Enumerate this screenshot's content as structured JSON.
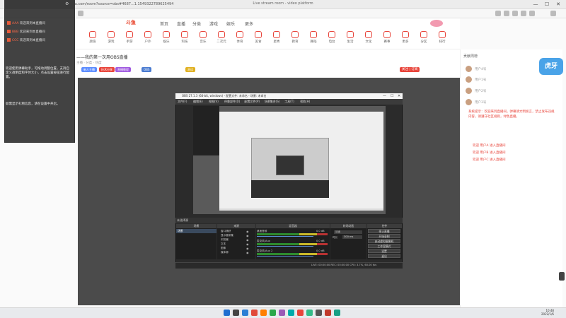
{
  "browser": {
    "tab_title": "Live stream room - video platform",
    "url": "https://www.douyu.com/room?source=obs#4687...1.1549322789625494",
    "controls": {
      "minimize": "—",
      "maximize": "☐",
      "close": "✕"
    }
  },
  "site": {
    "logo": "斗鱼",
    "nav": [
      "首页",
      "直播",
      "分类",
      "游戏",
      "娱乐",
      "更多"
    ],
    "categories": [
      "颜值",
      "游戏",
      "手游",
      "户外",
      "娱乐",
      "科技",
      "音乐",
      "二次元",
      "体育",
      "美食",
      "星秀",
      "教育",
      "舞蹈",
      "电台",
      "生活",
      "文化",
      "赛事",
      "更多",
      "分区",
      "排行"
    ]
  },
  "room": {
    "title": "——我的第一次用OBS直播",
    "subtitle": "主播 · 分类 · 热度",
    "tags": [
      "新人主播",
      "技术分享",
      "直播教程",
      "OBS",
      "测试"
    ],
    "follow_button": "关注 | 订阅"
  },
  "rank": {
    "header": "贡献周榜",
    "rows": [
      "用户1号",
      "用户2号",
      "用户3号",
      "用户4号"
    ]
  },
  "chat": {
    "note": "系统提示：欢迎来到直播间，弹幕请文明发言，禁止发布违规内容，请遵守社区规则，绿色直播。",
    "lines": [
      "欢迎 用户A 进入直播间",
      "欢迎 用户B 进入直播间",
      "欢迎 用户C 进入直播间"
    ]
  },
  "badge": {
    "text": "虎牙"
  },
  "dock": {
    "rows": [
      {
        "name": "AAA",
        "text": "欢迎来到本直播间"
      },
      {
        "name": "BBB",
        "text": "欢迎来到本直播间"
      },
      {
        "name": "CCC",
        "text": "欢迎来到本直播间"
      }
    ],
    "message1": "欢迎使用弹幕助手，可拖动调整位置，支持自定义透明度和字体大小，点击设置按钮进行配置。",
    "message2": "如需显示礼物信息，请在设置中开启。"
  },
  "obs": {
    "title": "OBS 27.1.3 (64-bit, windows) - 配置文件: 未命名 - 场景: 未命名",
    "menu": [
      "文件(F)",
      "编辑(E)",
      "视图(V)",
      "停靠部件(D)",
      "配置文件(P)",
      "场景集合(S)",
      "工具(T)",
      "帮助(H)"
    ],
    "stage_label": "未选择源",
    "panels": [
      "场景",
      "来源",
      "混音器",
      "转场动画",
      "控件"
    ],
    "scene": "场景",
    "sources": [
      "窗口捕获",
      "显示器采集",
      "浏览器",
      "文本",
      "图像",
      "媒体源"
    ],
    "mixer": [
      "桌面音频",
      "麦克风/Aux",
      "麦克风/Aux 2"
    ],
    "mixer_db": [
      "0.0 dB",
      "0.0 dB",
      "0.0 dB"
    ],
    "transition": {
      "name": "淡出",
      "duration_label": "时长",
      "duration": "300 ms"
    },
    "controls": [
      "停止直播",
      "开始录制",
      "启动虚拟摄像机",
      "工作室模式",
      "设置",
      "退出"
    ],
    "status": "LIVE: 00:00:00   REC: 00:00:00   CPU: 3.7%, 60.00 fps"
  },
  "taskbar": {
    "time": "10:48",
    "date": "2022/1/6",
    "app_colors": [
      "#1f6fd0",
      "#444444",
      "#2a7fd4",
      "#e04a3a",
      "#ff7f00",
      "#2aa84a",
      "#9b59b6",
      "#0aa",
      "#e8443a",
      "#3b8",
      "#555555",
      "#c0392b",
      "#16a085"
    ]
  },
  "colors": {
    "accent": "#e8443a",
    "obs_bg": "#2b2b2b",
    "stream_bg": "#4b4b4b"
  }
}
